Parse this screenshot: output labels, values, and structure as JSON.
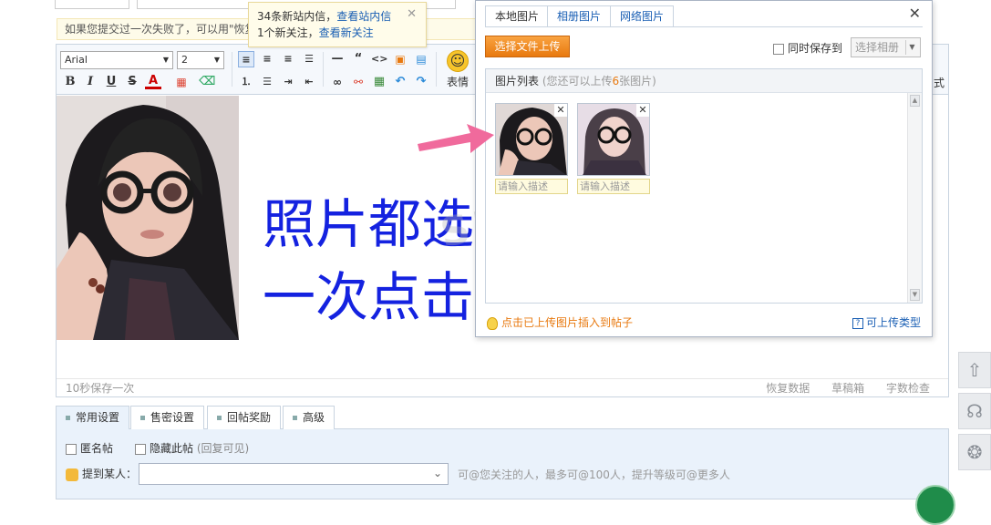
{
  "notice": {
    "text": "如果您提交过一次失败了，可以用\"恢复"
  },
  "toolbar": {
    "font_family": "Arial",
    "font_size": "2",
    "emoji_label": "表情",
    "cut_label": "式"
  },
  "overlay_text": {
    "line1": "照片都选好后",
    "line2": "一次点击"
  },
  "editor_footer": {
    "autosave": "10秒保存一次",
    "restore": "恢复数据",
    "drafts": "草稿箱",
    "word_check": "字数检查"
  },
  "tooltip": {
    "line1_prefix": "34条新站内信，",
    "line1_link": "查看站内信",
    "line2_prefix": "1个新关注，",
    "line2_link": "查看新关注"
  },
  "dialog": {
    "tabs": [
      "本地图片",
      "相册图片",
      "网络图片"
    ],
    "upload_button": "选择文件上传",
    "save_to_label": "同时保存到",
    "album_select": "选择相册",
    "list_title": "图片列表",
    "list_note_prefix": "(您还可以上传",
    "list_note_num": "6",
    "list_note_suffix": "张图片)",
    "desc_placeholder": "请输入描述",
    "insert_hint": "点击已上传图片插入到帖子",
    "types_link": "可上传类型"
  },
  "settings": {
    "tabs": [
      "常用设置",
      "售密设置",
      "回帖奖励",
      "高级"
    ],
    "anonymous": "匿名帖",
    "hide_post": "隐藏此帖",
    "hide_note": "(回复可见)",
    "mention_label": "提到某人：",
    "mention_hint": "可@您关注的人，最多可@100人，提升等级可@更多人"
  },
  "colors": {
    "accent_orange": "#e8790f",
    "link_blue": "#1a5fb4",
    "overlay_blue": "#1422e0",
    "arrow_pink": "#f06a9c"
  }
}
